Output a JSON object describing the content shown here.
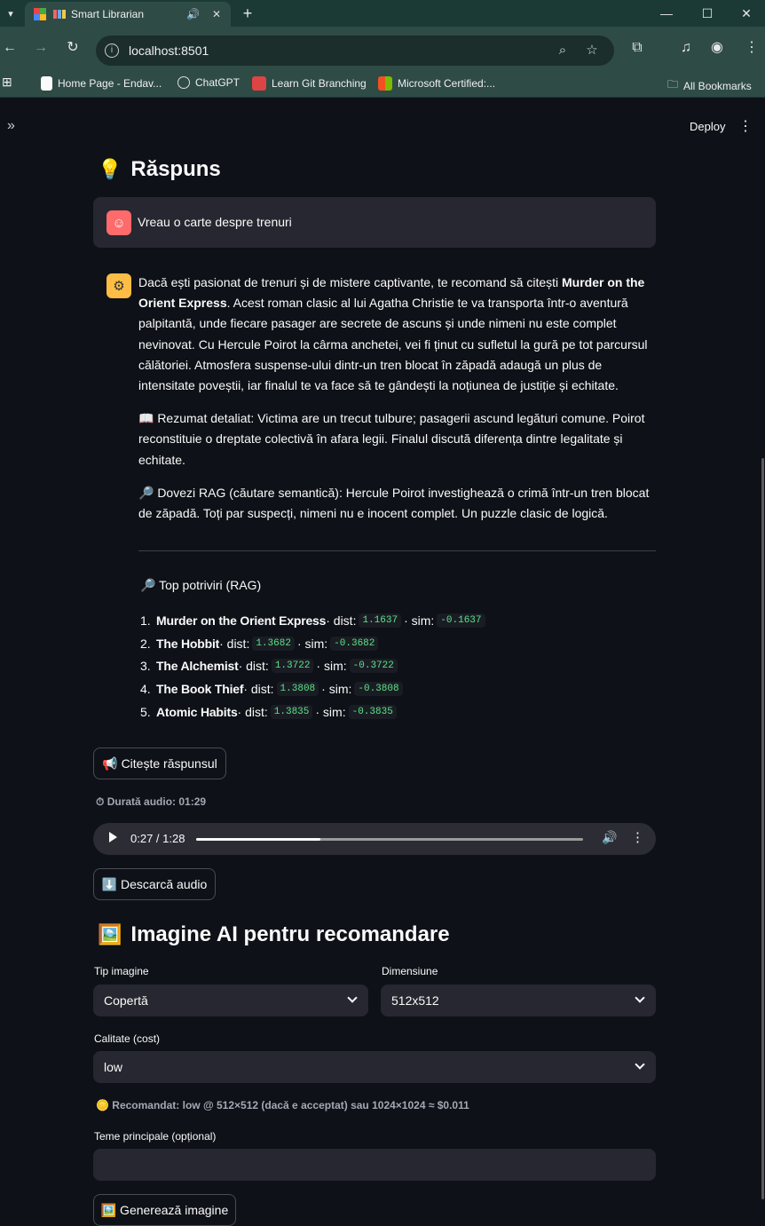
{
  "browser": {
    "tab_title": "Smart Librarian",
    "url": "localhost:8501",
    "bookmarks": [
      {
        "label": "Home Page - Endav...",
        "color": "#2b5797"
      },
      {
        "label": "ChatGPT",
        "color": "#3a3a3a"
      },
      {
        "label": "Learn Git Branching",
        "color": "#d44"
      },
      {
        "label": "Microsoft Certified:...",
        "color": "#f25022"
      }
    ],
    "all_bookmarks": "All Bookmarks"
  },
  "app": {
    "deploy_label": "Deploy",
    "response_heading": "Răspuns",
    "user_message": "Vreau o carte despre trenuri",
    "assistant": {
      "p1_pre": "Dacă ești pasionat de trenuri și de mistere captivante, te recomand să citești ",
      "p1_bold": "Murder on the Orient Express",
      "p1_post": ". Acest roman clasic al lui Agatha Christie te va transporta într-o aventură palpitantă, unde fiecare pasager are secrete de ascuns și unde nimeni nu este complet nevinovat. Cu Hercule Poirot la cârma anchetei, vei fi ținut cu sufletul la gură pe tot parcursul călătoriei. Atmosfera suspense-ului dintr-un tren blocat în zăpadă adaugă un plus de intensitate poveștii, iar finalul te va face să te gândești la noțiunea de justiție și echitate.",
      "p2": "📖 Rezumat detaliat: Victima are un trecut tulbure; pasagerii ascund legături comune. Poirot reconstituie o dreptate colectivă în afara legii. Finalul discută diferența dintre legalitate și echitate.",
      "p3": "🔎 Dovezi RAG (căutare semantică): Hercule Poirot investighează o crimă într-un tren blocat de zăpadă. Toți par suspecți, nimeni nu e inocent complet. Un puzzle clasic de logică."
    },
    "top_title": "🔎 Top potriviri (RAG)",
    "dist_label": " · dist: ",
    "sim_label": " · sim: ",
    "matches": [
      {
        "num": "1.",
        "title": "Murder on the Orient Express",
        "dist": "1.1637",
        "sim": "-0.1637"
      },
      {
        "num": "2.",
        "title": "The Hobbit",
        "dist": "1.3682",
        "sim": "-0.3682"
      },
      {
        "num": "3.",
        "title": "The Alchemist",
        "dist": "1.3722",
        "sim": "-0.3722"
      },
      {
        "num": "4.",
        "title": "The Book Thief",
        "dist": "1.3808",
        "sim": "-0.3808"
      },
      {
        "num": "5.",
        "title": "Atomic Habits",
        "dist": "1.3835",
        "sim": "-0.3835"
      }
    ],
    "read_button": "📢 Citește răspunsul",
    "audio_duration": "⏱ Durată audio: 01:29",
    "audio_time": "0:27 / 1:28",
    "audio_progress": 0.32,
    "download_button": "⬇️ Descarcă audio",
    "image_heading": "Imagine AI pentru recomandare",
    "image_type_label": "Tip imagine",
    "image_type_value": "Copertă",
    "dimension_label": "Dimensiune",
    "dimension_value": "512x512",
    "quality_label": "Calitate (cost)",
    "quality_value": "low",
    "recommended": "🪙 Recomandat: low @ 512×512 (dacă e acceptat) sau 1024×1024 ≈ $0.011",
    "themes_label": "Teme principale (opțional)",
    "themes_value": "",
    "generate_button": "🖼️ Generează imagine"
  }
}
